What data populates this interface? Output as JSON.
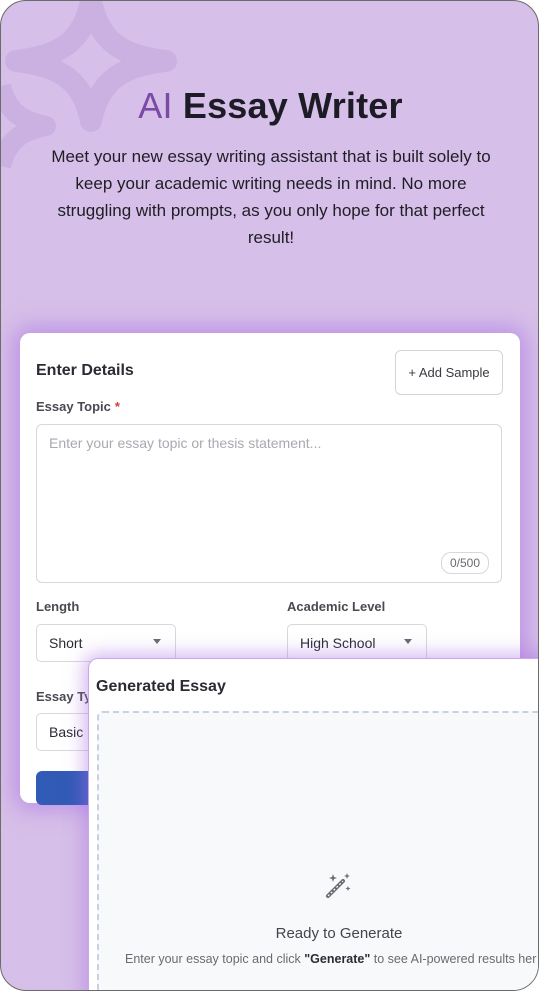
{
  "hero": {
    "title_ai": "AI",
    "title_rest": " Essay Writer",
    "description": "Meet your new essay writing assistant that is built solely to keep your academic writing needs in mind. No more struggling with prompts, as you only hope for that perfect result!"
  },
  "form": {
    "title": "Enter Details",
    "add_sample_label": "+ Add Sample",
    "topic_label": "Essay Topic",
    "required_mark": "*",
    "topic_placeholder": "Enter your essay topic or thesis statement...",
    "topic_counter": "0/500",
    "length_label": "Length",
    "length_value": "Short",
    "academic_level_label": "Academic Level",
    "academic_level_value": "High School",
    "essay_type_label": "Essay Ty",
    "essay_type_value": "Basic"
  },
  "result": {
    "title": "Generated Essay",
    "ready_title": "Ready to Generate",
    "ready_prefix": "Enter your essay topic and click ",
    "ready_bold": "\"Generate\"",
    "ready_suffix": " to see AI-powered results her"
  },
  "colors": {
    "background": "#d6bfe8",
    "accent_purple": "#7b4aa6",
    "button_gradient_start": "#2f5bb6",
    "button_gradient_end": "#5b4fc4",
    "required": "#d23c3c"
  },
  "icons": {
    "add_sample": "plus-icon",
    "dropdown": "chevron-down-icon",
    "ready": "magic-wand-icon"
  }
}
